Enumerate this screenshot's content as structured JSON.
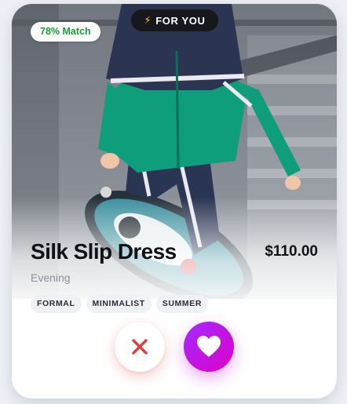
{
  "card": {
    "match_label": "78% Match",
    "for_you_label": "FOR YOU",
    "title": "Silk Slip Dress",
    "price": "$110.00",
    "category": "Evening",
    "tags": [
      "FORMAL",
      "MINIMALIST",
      "SUMMER"
    ]
  },
  "icons": {
    "for_you": "lightning-bolt-icon",
    "dislike": "close-x-icon",
    "like": "heart-icon"
  },
  "colors": {
    "match_text": "#1a9b3c",
    "badge_dark": "#17181c",
    "bolt": "#ffc21a",
    "dislike_icon": "#e23b3b",
    "like_gradient_start": "#a12bff",
    "like_gradient_end": "#e000c8"
  }
}
